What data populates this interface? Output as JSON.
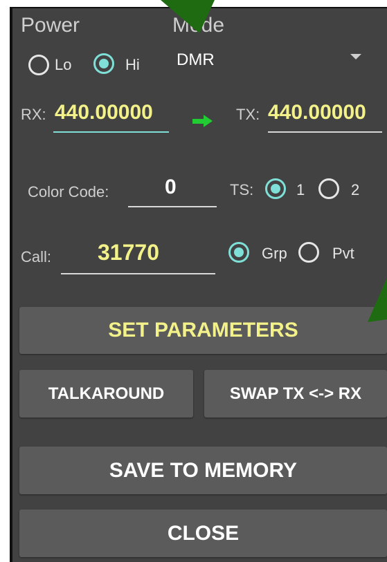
{
  "power": {
    "label": "Power",
    "options": [
      "Lo",
      "Hi"
    ],
    "selected": "Hi"
  },
  "mode": {
    "label": "Mode",
    "value": "DMR"
  },
  "rx": {
    "label": "RX:",
    "value": "440.00000"
  },
  "tx": {
    "label": "TX:",
    "value": "440.00000"
  },
  "color_code": {
    "label": "Color Code:",
    "value": "0"
  },
  "ts": {
    "label": "TS:",
    "options": [
      "1",
      "2"
    ],
    "selected": "1"
  },
  "call": {
    "label": "Call:",
    "value": "31770"
  },
  "call_type": {
    "options": [
      "Grp",
      "Pvt"
    ],
    "selected": "Grp"
  },
  "buttons": {
    "set_parameters": "SET PARAMETERS",
    "talkaround": "TALKAROUND",
    "swap": "SWAP TX <-> RX",
    "save_memory": "SAVE TO MEMORY",
    "close": "CLOSE"
  },
  "colors": {
    "panel": "#424242",
    "button": "#5b5b5b",
    "value": "#f3f28a",
    "accent": "#7fe0d8",
    "arrow": "#22cc33",
    "annotation_arrow": "#1f6b12"
  }
}
